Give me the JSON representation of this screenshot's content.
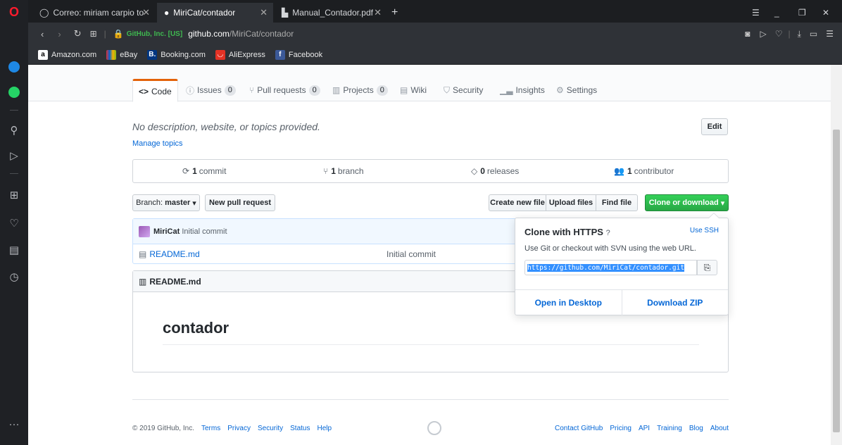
{
  "browser": {
    "tabs": [
      {
        "label": "Correo: miriam carpio toler",
        "active": false
      },
      {
        "label": "MiriCat/contador",
        "active": true
      },
      {
        "label": "Manual_Contador.pdf",
        "active": false
      }
    ],
    "cert": "GitHub, Inc. [US]",
    "url_host": "github.com",
    "url_path": "/MiriCat/contador",
    "bookmarks": [
      "Amazon.com",
      "eBay",
      "Booking.com",
      "AliExpress",
      "Facebook"
    ]
  },
  "repo_tabs": [
    {
      "label": "Code",
      "count": null
    },
    {
      "label": "Issues",
      "count": "0"
    },
    {
      "label": "Pull requests",
      "count": "0"
    },
    {
      "label": "Projects",
      "count": "0"
    },
    {
      "label": "Wiki",
      "count": null
    },
    {
      "label": "Security",
      "count": null
    },
    {
      "label": "Insights",
      "count": null
    },
    {
      "label": "Settings",
      "count": null
    }
  ],
  "about": {
    "description": "No description, website, or topics provided.",
    "manage_topics": "Manage topics",
    "edit": "Edit"
  },
  "summary": {
    "commits_n": "1",
    "commits_label": "commit",
    "branches_n": "1",
    "branches_label": "branch",
    "releases_n": "0",
    "releases_label": "releases",
    "contributors_n": "1",
    "contributors_label": "contributor"
  },
  "toolbar": {
    "branch_label": "Branch:",
    "branch_value": "master",
    "new_pr": "New pull request",
    "create_file": "Create new file",
    "upload_files": "Upload files",
    "find_file": "Find file",
    "clone_download": "Clone or download"
  },
  "commit": {
    "author": "MiriCat",
    "message": "Initial commit",
    "file_name": "README.md",
    "file_message": "Initial commit"
  },
  "readme": {
    "header": "README.md",
    "title": "contador"
  },
  "clone": {
    "title": "Clone with HTTPS",
    "use_ssh": "Use SSH",
    "hint": "Use Git or checkout with SVN using the web URL.",
    "url": "https://github.com/MiriCat/contador.git",
    "open_desktop": "Open in Desktop",
    "download_zip": "Download ZIP"
  },
  "footer": {
    "copyright": "© 2019 GitHub, Inc.",
    "left_links": [
      "Terms",
      "Privacy",
      "Security",
      "Status",
      "Help"
    ],
    "right_links": [
      "Contact GitHub",
      "Pricing",
      "API",
      "Training",
      "Blog",
      "About"
    ]
  }
}
